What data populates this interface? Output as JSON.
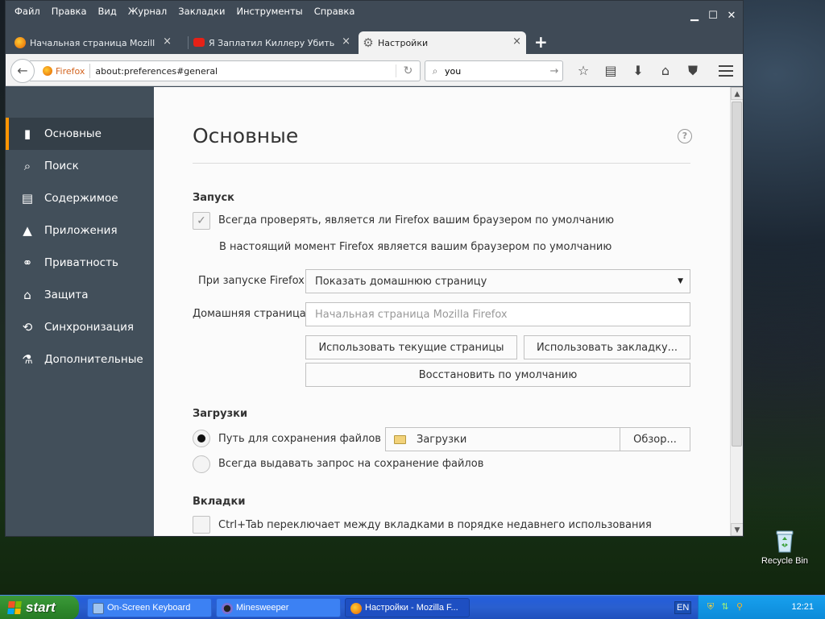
{
  "menubar": [
    "Файл",
    "Правка",
    "Вид",
    "Журнал",
    "Закладки",
    "Инструменты",
    "Справка"
  ],
  "window_controls": {
    "minimize": "▁",
    "maximize": "☐",
    "close": "✕"
  },
  "tabs": [
    {
      "title": "Начальная страница Mozilla ...",
      "icon": "firefox-icon",
      "active": false
    },
    {
      "title": "Я Заплатил Киллеру Убить ...",
      "icon": "youtube-icon",
      "active": false
    },
    {
      "title": "Настройки",
      "icon": "gear-icon",
      "active": true
    }
  ],
  "tab_close": "×",
  "new_tab": "+",
  "navbar": {
    "back": "←",
    "identity_label": "Firefox",
    "url": "about:preferences#general",
    "reload": "↻",
    "search_value": "you",
    "search_go": "→"
  },
  "toolbar_icons": [
    "star-icon",
    "reading-list-icon",
    "download-icon",
    "home-icon",
    "pocket-icon",
    "menu-icon"
  ],
  "toolbar_glyphs": {
    "star": "☆",
    "list": "▤",
    "download": "⬇",
    "home": "⌂",
    "pocket": "⛊"
  },
  "sidebar": {
    "items": [
      {
        "label": "Основные",
        "icon": "general-icon",
        "glyph": "▮",
        "selected": true
      },
      {
        "label": "Поиск",
        "icon": "search-icon",
        "glyph": "🔍︎",
        "selected": false
      },
      {
        "label": "Содержимое",
        "icon": "content-icon",
        "glyph": "▤",
        "selected": false
      },
      {
        "label": "Приложения",
        "icon": "applications-icon",
        "glyph": "▲",
        "selected": false
      },
      {
        "label": "Приватность",
        "icon": "privacy-mask-icon",
        "glyph": "⚭",
        "selected": false
      },
      {
        "label": "Защита",
        "icon": "security-lock-icon",
        "glyph": "⌂",
        "selected": false
      },
      {
        "label": "Синхронизация",
        "icon": "sync-icon",
        "glyph": "⟲",
        "selected": false
      },
      {
        "label": "Дополнительные",
        "icon": "advanced-icon",
        "glyph": "⚗",
        "selected": false
      }
    ]
  },
  "pane": {
    "title": "Основные",
    "help": "?",
    "startup": {
      "heading": "Запуск",
      "default_check_label": "Всегда проверять, является ли Firefox вашим браузером по умолчанию",
      "default_check_checked": true,
      "default_status": "В настоящий момент Firefox является вашим браузером по умолчанию",
      "on_start_label": "При запуске Firefox:",
      "on_start_value": "Показать домашнюю страницу",
      "home_label": "Домашняя страница:",
      "home_placeholder": "Начальная страница Mozilla Firefox",
      "use_current_btn": "Использовать текущие страницы",
      "use_bookmark_btn": "Использовать закладку...",
      "restore_default_btn": "Восстановить по умолчанию"
    },
    "downloads": {
      "heading": "Загрузки",
      "save_path_label": "Путь для сохранения файлов",
      "save_path_checked": true,
      "folder_value": "Загрузки",
      "browse_btn": "Обзор...",
      "always_ask_label": "Всегда выдавать запрос на сохранение файлов",
      "always_ask_checked": false
    },
    "tabs_section": {
      "heading": "Вкладки",
      "ctrl_tab_label": "Ctrl+Tab переключает между вкладками в порядке недавнего использования",
      "ctrl_tab_checked": false
    }
  },
  "desktop": {
    "recycle_bin_label": "Recycle Bin"
  },
  "taskbar": {
    "start_label": "start",
    "tasks": [
      {
        "label": "On-Screen Keyboard",
        "icon": "keyboard-icon",
        "active": false
      },
      {
        "label": "Minesweeper",
        "icon": "minesweeper-icon",
        "active": false
      },
      {
        "label": "Настройки - Mozilla F...",
        "icon": "firefox-icon",
        "active": true
      }
    ],
    "language": "EN",
    "clock": "12:21"
  },
  "colors": {
    "accent_orange": "#ff9500",
    "sidebar_bg": "#424f5a",
    "taskbar_blue": "#245edb",
    "start_green": "#2f8a2d"
  }
}
